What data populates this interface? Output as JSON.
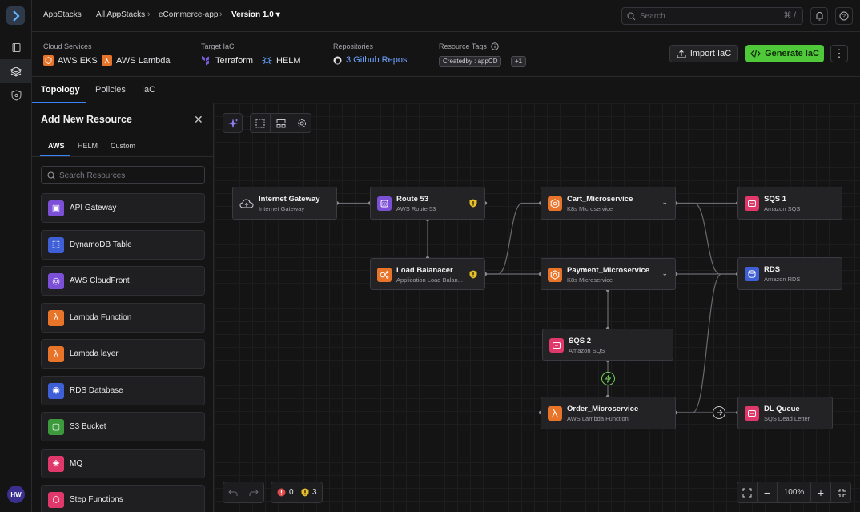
{
  "breadcrumb": [
    "AppStacks",
    "All AppStacks",
    "eCommerce-app",
    "Version 1.0"
  ],
  "search": {
    "placeholder": "Search",
    "shortcut": "⌘ /"
  },
  "info": {
    "cloud_label": "Cloud Services",
    "cloud": [
      "AWS EKS",
      "AWS Lambda"
    ],
    "iac_label": "Target IaC",
    "iac": [
      "Terraform",
      "HELM"
    ],
    "repo_label": "Repositories",
    "repos": "3 Github Repos",
    "tags_label": "Resource Tags",
    "tag": "Createdby : appCD",
    "tag_more": "+1"
  },
  "actions": {
    "import": "Import IaC",
    "generate": "Generate IaC"
  },
  "tabs": [
    "Topology",
    "Policies",
    "IaC"
  ],
  "panel": {
    "title": "Add New Resource",
    "subtabs": [
      "AWS",
      "HELM",
      "Custom"
    ],
    "search_placeholder": "Search Resources",
    "resources": [
      {
        "label": "API Gateway",
        "color": "#7b4fd6"
      },
      {
        "label": "DynamoDB Table",
        "color": "#3f5fd6"
      },
      {
        "label": "AWS CloudFront",
        "color": "#7b4fd6"
      },
      {
        "label": "Lambda Function",
        "color": "#e8742a"
      },
      {
        "label": "Lambda layer",
        "color": "#e8742a"
      },
      {
        "label": "RDS Database",
        "color": "#3f5fd6"
      },
      {
        "label": "S3 Bucket",
        "color": "#3c9a3c"
      },
      {
        "label": "MQ",
        "color": "#e0386a"
      },
      {
        "label": "Step Functions",
        "color": "#e0386a"
      }
    ]
  },
  "nodes": {
    "igw": {
      "title": "Internet Gateway",
      "sub": "Internet Gateway"
    },
    "r53": {
      "title": "Route 53",
      "sub": "AWS Route 53"
    },
    "lb": {
      "title": "Load Balanacer",
      "sub": "Application Load Balan..."
    },
    "cart": {
      "title": "Cart_Microservice",
      "sub": "K8s Microservice"
    },
    "pay": {
      "title": "Payment_Microservice",
      "sub": "K8s Microservice"
    },
    "sqs2": {
      "title": "SQS 2",
      "sub": "Amazon SQS"
    },
    "order": {
      "title": "Order_Microservice",
      "sub": "AWS Lambda Function"
    },
    "sqs1": {
      "title": "SQS 1",
      "sub": "Amazon SQS"
    },
    "rds": {
      "title": "RDS",
      "sub": "Amazon RDS"
    },
    "dlq": {
      "title": "DL Queue",
      "sub": "SQS Dead Letter"
    }
  },
  "status": {
    "errors": "0",
    "warnings": "3"
  },
  "zoom": "100%",
  "user_initials": "HW",
  "colors": {
    "accent": "#3b82f6",
    "generate": "#4fc83a",
    "aws_orange": "#e8742a",
    "aws_pink": "#e0386a",
    "aws_purple": "#7b4fd6"
  }
}
